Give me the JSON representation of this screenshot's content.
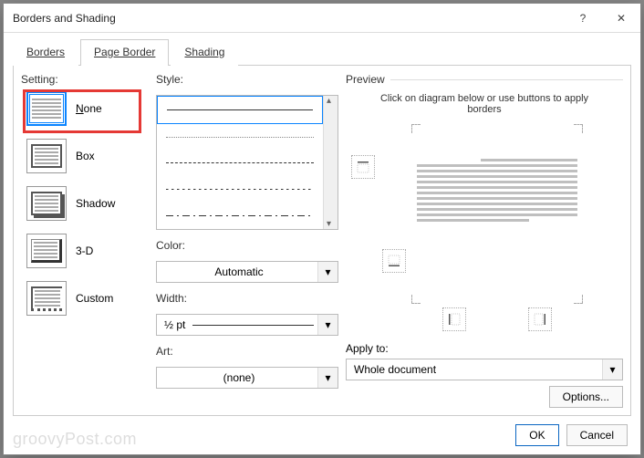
{
  "title": "Borders and Shading",
  "titlebar": {
    "help": "?",
    "close": "✕"
  },
  "tabs": {
    "borders": "Borders",
    "page_border": "Page Border",
    "shading": "Shading"
  },
  "setting": {
    "label": "Setting:",
    "none": "None",
    "box": "Box",
    "shadow": "Shadow",
    "threed": "3-D",
    "custom": "Custom"
  },
  "style": {
    "label": "Style:",
    "color_label": "Color:",
    "color_value": "Automatic",
    "width_label": "Width:",
    "width_value": "½ pt",
    "art_label": "Art:",
    "art_value": "(none)"
  },
  "preview": {
    "label": "Preview",
    "hint": "Click on diagram below or use buttons to apply borders",
    "apply_label": "Apply to:",
    "apply_value": "Whole document",
    "options_label": "Options..."
  },
  "footer": {
    "ok": "OK",
    "cancel": "Cancel"
  },
  "watermark": "groovyPost.com"
}
